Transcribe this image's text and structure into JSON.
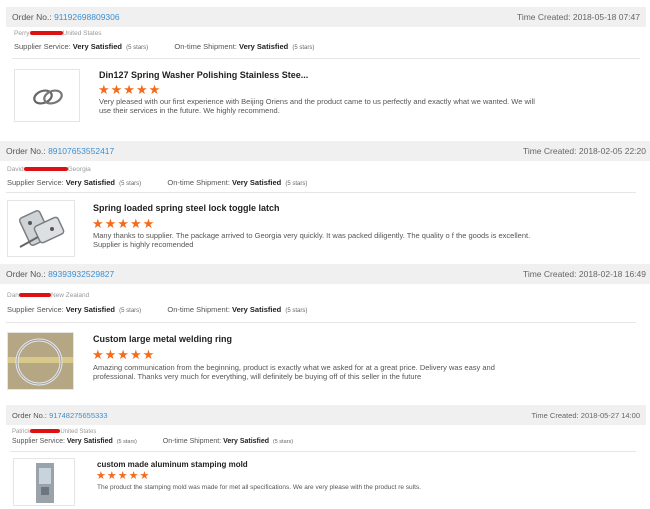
{
  "labels": {
    "order_no": "Order No.:",
    "time_created": "Time Created:",
    "supplier_service": "Supplier Service:",
    "ontime_shipment": "On-time Shipment:",
    "stars_note": "(5 stars)"
  },
  "reviews": [
    {
      "order_no": "91192698809306",
      "time": "2018-05-18 07:47",
      "buyer_first": "Perry",
      "buyer_country": "United States",
      "supplier_rating": "Very Satisfied",
      "shipment_rating": "Very Satisfied",
      "product_title": "Din127 Spring Washer Polishing Stainless Stee...",
      "stars": 5,
      "star_text": "★★★★★",
      "review_text": "Very pleased with our first experience with Beijing Oriens and the product came to us perfectly and exactly what we wanted. We will use their services in the future. We highly recommend.",
      "thumb_icon": "spring-washer-image"
    },
    {
      "order_no": "89107653552417",
      "time": "2018-02-05 22:20",
      "buyer_first": "David",
      "buyer_country": "Georgia",
      "supplier_rating": "Very Satisfied",
      "shipment_rating": "Very Satisfied",
      "product_title": "Spring loaded spring steel lock toggle latch",
      "stars": 5,
      "star_text": "★★★★★",
      "review_text": "Many thanks to supplier. The package arrived to Georgia very quickly. It was packed diligently. The quality o f the goods is excellent. Supplier is highly recomended",
      "thumb_icon": "toggle-latch-image"
    },
    {
      "order_no": "89393932529827",
      "time": "2018-02-18 16:49",
      "buyer_first": "Dan",
      "buyer_country": "New Zealand",
      "supplier_rating": "Very Satisfied",
      "shipment_rating": "Very Satisfied",
      "product_title": "Custom large metal welding ring",
      "stars": 5,
      "star_text": "★★★★★",
      "review_text": "Amazing communication from the beginning, product is exactly what we asked for at a great price. Delivery was easy and professional. Thanks very much for everything, will definitely be buying off of this seller in the future",
      "thumb_icon": "welding-ring-image"
    },
    {
      "order_no": "91748275655333",
      "time": "2018-05-27 14:00",
      "buyer_first": "Patrick",
      "buyer_country": "United States",
      "supplier_rating": "Very Satisfied",
      "shipment_rating": "Very Satisfied",
      "product_title": "custom made aluminum stamping mold",
      "stars": 5,
      "star_text": "★★★★★",
      "review_text": "The product the stamping mold was made for met all specifications. We are very please with the product re sults.",
      "thumb_icon": "stamping-mold-image"
    }
  ]
}
